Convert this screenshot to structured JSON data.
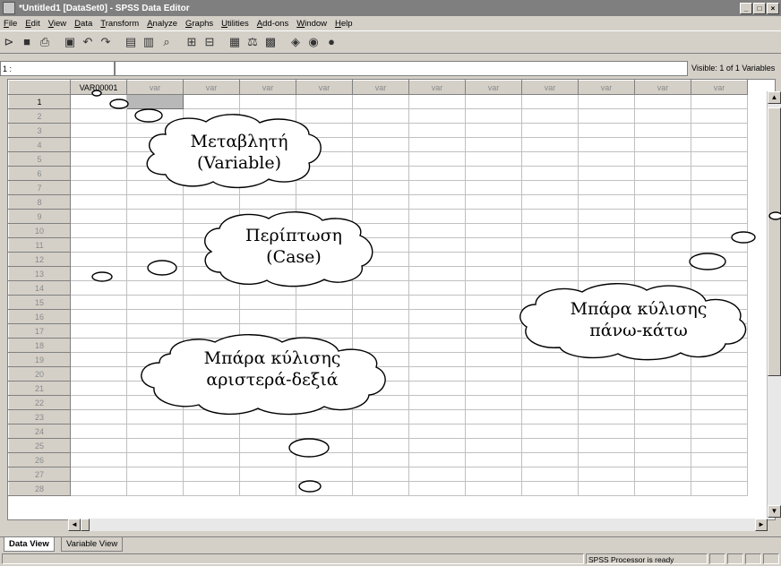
{
  "window": {
    "title": "*Untitled1 [DataSet0] - SPSS Data Editor"
  },
  "menu": [
    "File",
    "Edit",
    "View",
    "Data",
    "Transform",
    "Analyze",
    "Graphs",
    "Utilities",
    "Add-ons",
    "Window",
    "Help"
  ],
  "toolbar_icons": [
    "open-icon",
    "save-icon",
    "print-icon",
    "dialog-recall-icon",
    "undo-icon",
    "redo-icon",
    "goto-case-icon",
    "variables-icon",
    "find-icon",
    "insert-cases-icon",
    "insert-variable-icon",
    "split-file-icon",
    "weight-cases-icon",
    "select-cases-icon",
    "value-labels-icon",
    "use-sets-icon",
    "show-all-icon"
  ],
  "cell_editor": {
    "reference": "1 :",
    "value": "",
    "visible": "Visible: 1 of 1 Variables"
  },
  "grid": {
    "columns": [
      "VAR00001",
      "var",
      "var",
      "var",
      "var",
      "var",
      "var",
      "var",
      "var",
      "var",
      "var",
      "var"
    ],
    "rows": [
      "1",
      "2",
      "3",
      "4",
      "5",
      "6",
      "7",
      "8",
      "9",
      "10",
      "11",
      "12",
      "13",
      "14",
      "15",
      "16",
      "17",
      "18",
      "19",
      "20",
      "21",
      "22",
      "23",
      "24",
      "25",
      "26",
      "27",
      "28"
    ]
  },
  "tabs": {
    "data_view": "Data View",
    "variable_view": "Variable View"
  },
  "status": {
    "processor": "SPSS  Processor is ready"
  },
  "callouts": {
    "variable": [
      "Μεταβλητή",
      "(Variable)"
    ],
    "case": [
      "Περίπτωση",
      "(Case)"
    ],
    "hscroll": [
      "Μπάρα κύλισης",
      "αριστερά-δεξιά"
    ],
    "vscroll": [
      "Μπάρα κύλισης",
      "πάνω-κάτω"
    ]
  }
}
